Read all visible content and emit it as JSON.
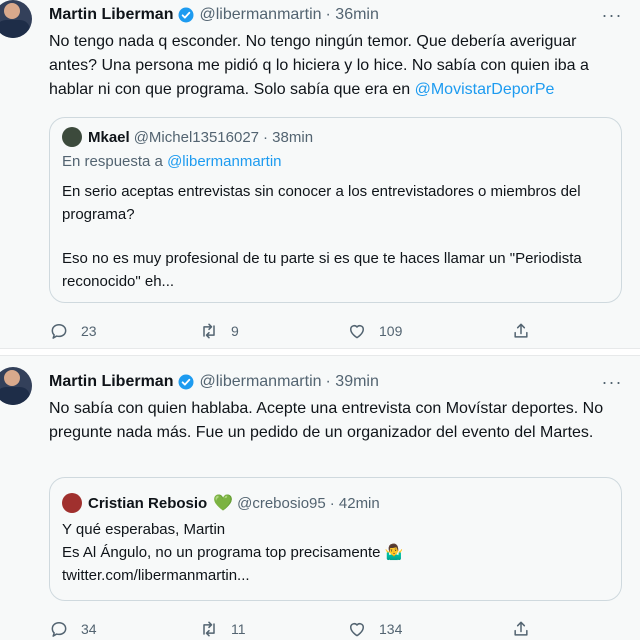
{
  "tweet1": {
    "author_name": "Martin Liberman",
    "handle": "@libermanmartin",
    "time": "· 36min",
    "text_main": "No tengo nada q esconder. No tengo ningún temor. Que debería averiguar antes? Una persona me pidió q lo hiciera y lo hice. No sabía con quien iba a hablar ni con que programa. Solo sabía que era en",
    "text_mention": "@MovistarDeporPe",
    "quoted": {
      "author_name": "Mkael",
      "handle": "@Michel13516027",
      "time": "· 38min",
      "reply_to_prefix": "En respuesta a",
      "reply_to_handle": "@libermanmartin",
      "paragraph1": "En serio aceptas entrevistas sin conocer a los entrevistadores o miembros del programa?",
      "paragraph2": "Eso no es muy profesional de tu parte si es que te haces llamar un \"Periodista reconocido\" eh..."
    },
    "replies": "23",
    "retweets": "9",
    "likes": "109"
  },
  "tweet2": {
    "author_name": "Martin Liberman",
    "handle": "@libermanmartin",
    "time": "· 39min",
    "text": "No sabía con quien hablaba. Acepte una entrevista con Movístar deportes. No pregunte nada más. Fue un pedido de un organizador del evento del Martes.",
    "quoted": {
      "author_name": "Cristian Rebosio",
      "heart_emoji": "💚",
      "handle": "@crebosio95",
      "time": "· 42min",
      "line1": "Y qué esperabas, Martin",
      "line2": "Es Al Ángulo, no un programa top precisamente 🤷‍♂️",
      "line3": "twitter.com/libermanmartin..."
    },
    "replies": "34",
    "retweets": "11",
    "likes": "134"
  },
  "colors": {
    "link": "#1d9bf0",
    "secondary_text": "#536471",
    "background": "#f7f9f9",
    "verified": "#1d9bf0"
  },
  "icons": [
    "more-icon",
    "verified-icon",
    "reply-icon",
    "retweet-icon",
    "like-icon",
    "share-icon"
  ]
}
